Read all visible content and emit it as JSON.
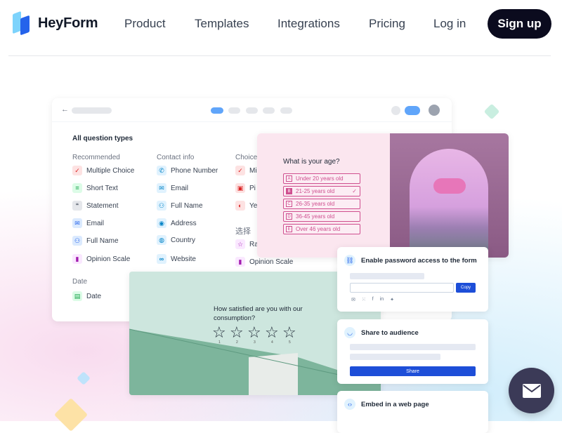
{
  "nav": {
    "brand": "HeyForm",
    "links": [
      "Product",
      "Templates",
      "Integrations",
      "Pricing",
      "Log in"
    ],
    "signup": "Sign up"
  },
  "builder": {
    "section_title": "All question types",
    "columns": [
      {
        "head": "Recommended",
        "items": [
          "Multiple Choice",
          "Short Text",
          "Statement",
          "Email",
          "Full Name",
          "Opinion Scale"
        ]
      },
      {
        "head": "Contact info",
        "items": [
          "Phone Number",
          "Email",
          "Full Name",
          "Address",
          "Country",
          "Website"
        ]
      },
      {
        "head": "Choice",
        "items": [
          "Mi",
          "Pi",
          "Ye"
        ]
      }
    ],
    "chinese_head": "选择",
    "chinese_items": [
      "Ra",
      "Opinion Scale"
    ],
    "date_head": "Date",
    "date_item": "Date"
  },
  "age": {
    "question": "What is your age?",
    "options": [
      {
        "key": "A",
        "label": "Under 20 years old",
        "selected": false
      },
      {
        "key": "B",
        "label": "21-25 years old",
        "selected": true
      },
      {
        "key": "C",
        "label": "26-35 years old",
        "selected": false
      },
      {
        "key": "D",
        "label": "36-45 years old",
        "selected": false
      },
      {
        "key": "E",
        "label": "Over 46 years old",
        "selected": false
      }
    ]
  },
  "satisfaction": {
    "question": "How satisfied are you with our consumption?",
    "scale": [
      "1",
      "2",
      "3",
      "4",
      "5"
    ]
  },
  "share_cards": {
    "password_title": "Enable password access to the form",
    "copy_label": "Copy",
    "audience_title": "Share to audience",
    "share_label": "Share",
    "embed_title": "Embed in a web page"
  },
  "colors": {
    "accent": "#2563eb",
    "pink": "#cf4f8f",
    "dark": "#0b0b1e"
  }
}
